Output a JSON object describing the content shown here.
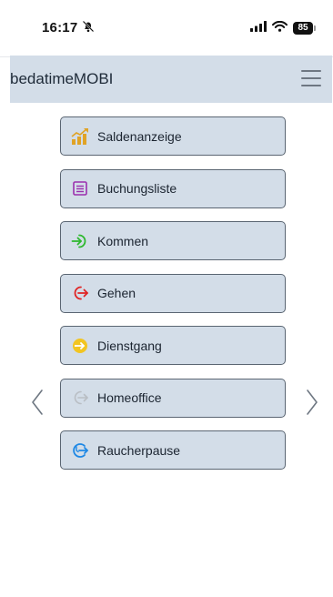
{
  "status": {
    "time": "16:17",
    "battery": "85"
  },
  "app": {
    "title": "bedatimeMOBI"
  },
  "menu": [
    {
      "label": "Saldenanzeige",
      "icon": "chart-icon",
      "color": "#e0a326"
    },
    {
      "label": "Buchungsliste",
      "icon": "list-icon",
      "color": "#9b2fae"
    },
    {
      "label": "Kommen",
      "icon": "sign-in-icon",
      "color": "#2db82d"
    },
    {
      "label": "Gehen",
      "icon": "sign-out-icon",
      "color": "#e02424"
    },
    {
      "label": "Dienstgang",
      "icon": "business-trip-icon",
      "color": "#f2c521"
    },
    {
      "label": "Homeoffice",
      "icon": "home-office-icon",
      "color": "#b9bec4"
    },
    {
      "label": "Raucherpause",
      "icon": "break-icon",
      "color": "#1e88e5"
    }
  ],
  "nav": {
    "prev_icon": "chevron-left-icon",
    "next_icon": "chevron-right-icon"
  }
}
